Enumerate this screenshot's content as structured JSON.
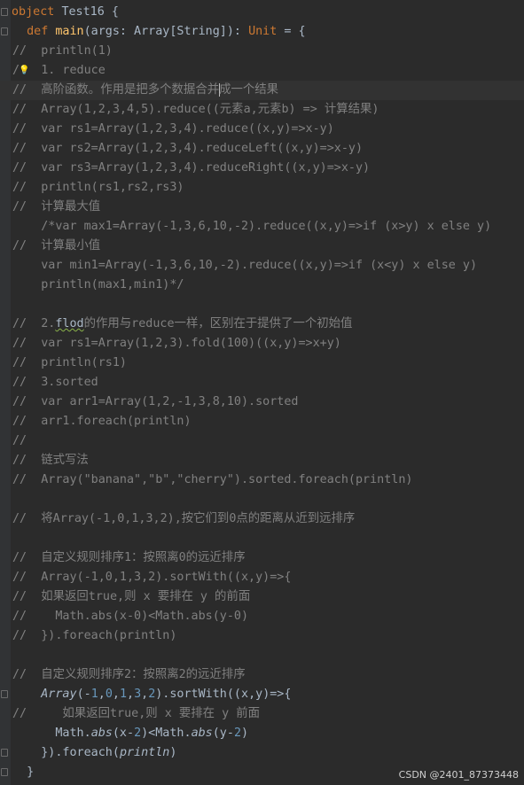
{
  "editor": {
    "lines": [
      {
        "marker": "",
        "parts": [
          [
            "kw",
            "object "
          ],
          [
            "plain",
            "Test16 {"
          ]
        ]
      },
      {
        "marker": "",
        "parts": [
          [
            "kw",
            "  def "
          ],
          [
            "fn",
            "main"
          ],
          [
            "plain",
            "(args: Array[String]): "
          ],
          [
            "kw",
            "Unit"
          ],
          [
            "plain",
            " = {"
          ]
        ]
      },
      {
        "marker": "//",
        "parts": [
          [
            "cmt",
            "    println(1)"
          ]
        ]
      },
      {
        "marker": "/",
        "bulb": true,
        "parts": [
          [
            "cmt",
            "    1. reduce"
          ]
        ]
      },
      {
        "marker": "//",
        "current": true,
        "parts": [
          [
            "cmt",
            "    高阶函数。作用是把多个数据合并"
          ],
          [
            "caret",
            ""
          ],
          [
            "cmt",
            "成一个结果"
          ]
        ]
      },
      {
        "marker": "//",
        "parts": [
          [
            "cmt",
            "    Array(1,2,3,4,5).reduce((元素a,元素b) => 计算结果)"
          ]
        ]
      },
      {
        "marker": "//",
        "parts": [
          [
            "cmt",
            "    var rs1=Array(1,2,3,4).reduce((x,y)=>x-y)"
          ]
        ]
      },
      {
        "marker": "//",
        "parts": [
          [
            "cmt",
            "    var rs2=Array(1,2,3,4).reduceLeft((x,y)=>x-y)"
          ]
        ]
      },
      {
        "marker": "//",
        "parts": [
          [
            "cmt",
            "    var rs3=Array(1,2,3,4).reduceRight((x,y)=>x-y)"
          ]
        ]
      },
      {
        "marker": "//",
        "parts": [
          [
            "cmt",
            "    println(rs1,rs2,rs3)"
          ]
        ]
      },
      {
        "marker": "//",
        "parts": [
          [
            "cmt",
            "    计算最大值"
          ]
        ]
      },
      {
        "marker": "",
        "parts": [
          [
            "cmt",
            "    /*var max1=Array(-1,3,6,10,-2).reduce((x,y)=>if (x>y) x else y)"
          ]
        ]
      },
      {
        "marker": "//",
        "parts": [
          [
            "cmt",
            "    计算最小值"
          ]
        ]
      },
      {
        "marker": "",
        "parts": [
          [
            "cmt",
            "    var min1=Array(-1,3,6,10,-2).reduce((x,y)=>if (x<y) x else y)"
          ]
        ]
      },
      {
        "marker": "",
        "parts": [
          [
            "cmt",
            "    println(max1,min1)*/"
          ]
        ]
      },
      {
        "marker": "",
        "parts": []
      },
      {
        "marker": "//",
        "parts": [
          [
            "cmt",
            "    2."
          ],
          [
            "squig",
            "flod"
          ],
          [
            "cmt",
            "的作用与reduce一样，区别在于提供了一个初始值"
          ]
        ]
      },
      {
        "marker": "//",
        "parts": [
          [
            "cmt",
            "    var rs1=Array(1,2,3).fold(100)((x,y)=>x+y)"
          ]
        ]
      },
      {
        "marker": "//",
        "parts": [
          [
            "cmt",
            "    println(rs1)"
          ]
        ]
      },
      {
        "marker": "//",
        "parts": [
          [
            "cmt",
            "    3.sorted"
          ]
        ]
      },
      {
        "marker": "//",
        "parts": [
          [
            "cmt",
            "    var arr1=Array(1,2,-1,3,8,10).sorted"
          ]
        ]
      },
      {
        "marker": "//",
        "parts": [
          [
            "cmt",
            "    arr1.foreach(println)"
          ]
        ]
      },
      {
        "marker": "//",
        "parts": []
      },
      {
        "marker": "//",
        "parts": [
          [
            "cmt",
            "    链式写法"
          ]
        ]
      },
      {
        "marker": "//",
        "parts": [
          [
            "cmt",
            "    Array(\"banana\",\"b\",\"cherry\").sorted.foreach(println)"
          ]
        ]
      },
      {
        "marker": "",
        "parts": []
      },
      {
        "marker": "//",
        "parts": [
          [
            "cmt",
            "    将Array(-1,0,1,3,2),按它们到0点的距离从近到远排序"
          ]
        ]
      },
      {
        "marker": "",
        "parts": []
      },
      {
        "marker": "//",
        "parts": [
          [
            "cmt",
            "    自定义规则排序1：按照离0的远近排序"
          ]
        ]
      },
      {
        "marker": "//",
        "parts": [
          [
            "cmt",
            "    Array(-1,0,1,3,2).sortWith((x,y)=>{"
          ]
        ]
      },
      {
        "marker": "//",
        "parts": [
          [
            "cmt",
            "    如果返回true,则 x 要排在 y 的前面"
          ]
        ]
      },
      {
        "marker": "//",
        "parts": [
          [
            "cmt",
            "      Math.abs(x-0)<Math.abs(y-0)"
          ]
        ]
      },
      {
        "marker": "//",
        "parts": [
          [
            "cmt",
            "    }).foreach(println)"
          ]
        ]
      },
      {
        "marker": "",
        "parts": []
      },
      {
        "marker": "//",
        "parts": [
          [
            "cmt",
            "    自定义规则排序2：按照离2的远近排序"
          ]
        ]
      },
      {
        "marker": "",
        "parts": [
          [
            "plain",
            "    "
          ],
          [
            "ity",
            "Array"
          ],
          [
            "plain",
            "(-"
          ],
          [
            "num",
            "1"
          ],
          [
            "plain",
            ","
          ],
          [
            "num",
            "0"
          ],
          [
            "plain",
            ","
          ],
          [
            "num",
            "1"
          ],
          [
            "plain",
            ","
          ],
          [
            "num",
            "3"
          ],
          [
            "plain",
            ","
          ],
          [
            "num",
            "2"
          ],
          [
            "plain",
            ").sortWith(("
          ],
          [
            "plain",
            "x"
          ],
          [
            "plain",
            ","
          ],
          [
            "plain",
            "y"
          ],
          [
            "plain",
            ")=>{"
          ]
        ]
      },
      {
        "marker": "//",
        "parts": [
          [
            "cmt",
            "       如果返回true,则 x 要排在 y 前面"
          ]
        ]
      },
      {
        "marker": "",
        "parts": [
          [
            "plain",
            "      Math."
          ],
          [
            "ifn",
            "abs"
          ],
          [
            "plain",
            "(x-"
          ],
          [
            "num",
            "2"
          ],
          [
            "plain",
            ")<Math."
          ],
          [
            "ifn",
            "abs"
          ],
          [
            "plain",
            "(y-"
          ],
          [
            "num",
            "2"
          ],
          [
            "plain",
            ")"
          ]
        ]
      },
      {
        "marker": "",
        "parts": [
          [
            "plain",
            "    }).foreach("
          ],
          [
            "ifn",
            "println"
          ],
          [
            "plain",
            ")"
          ]
        ]
      },
      {
        "marker": "",
        "parts": [
          [
            "plain",
            "  }"
          ]
        ]
      }
    ]
  },
  "watermark": "CSDN @2401_87373448"
}
